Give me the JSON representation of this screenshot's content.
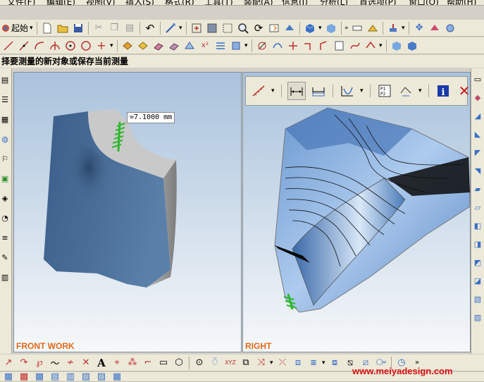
{
  "menu": {
    "items": [
      "文件(F)",
      "编辑(E)",
      "视图(V)",
      "插入(S)",
      "格式(R)",
      "工具(T)",
      "装配(A)",
      "信息(I)",
      "分析(L)",
      "首选项(P)",
      "窗口(O)",
      "帮助(H)"
    ]
  },
  "toolbar": {
    "start_label": "起始"
  },
  "status": {
    "prompt": "择要测量的新对象或保存当前测量"
  },
  "viewports": {
    "left_label": "FRONT WORK",
    "right_label": "RIGHT"
  },
  "measurement": {
    "value": "=7.1000 mm"
  },
  "watermark": {
    "text": "www.meiyadesign.com"
  },
  "colors": {
    "ui_face": "#ece9d8",
    "viewport_top": "#a9c2dc",
    "viewport_bottom": "#f6f8fa",
    "view_label": "#e06a1a",
    "part_blue": "#4a6e98",
    "highlight_green": "#2eb82e",
    "watermark": "#dd1111"
  }
}
